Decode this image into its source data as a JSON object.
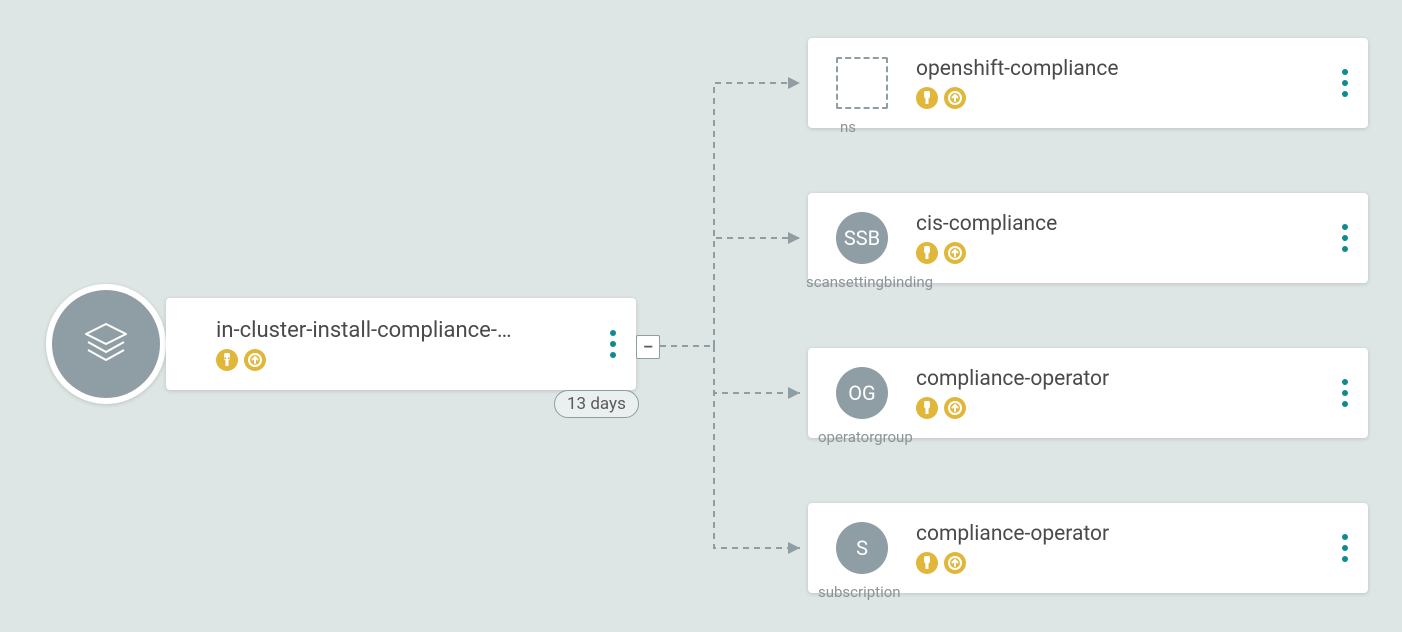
{
  "root": {
    "title": "in-cluster-install-compliance-…",
    "age": "13 days",
    "collapse": "–"
  },
  "children": [
    {
      "kind_short": "",
      "kind_long": "ns",
      "title": "openshift-compliance",
      "icon": "ns"
    },
    {
      "kind_short": "SSB",
      "kind_long": "scansettingbinding",
      "title": "cis-compliance",
      "icon": "circle"
    },
    {
      "kind_short": "OG",
      "kind_long": "operatorgroup",
      "title": "compliance-operator",
      "icon": "circle"
    },
    {
      "kind_short": "S",
      "kind_long": "subscription",
      "title": "compliance-operator",
      "icon": "circle"
    }
  ]
}
